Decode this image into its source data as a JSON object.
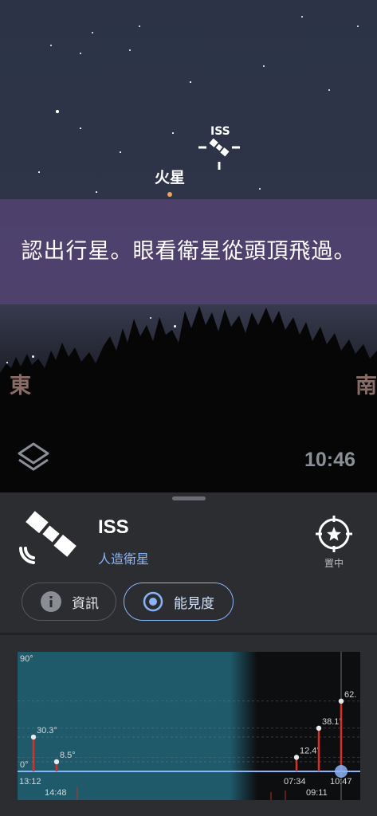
{
  "sky": {
    "planet_label": "火星",
    "satellite_label": "ISS",
    "banner_text": "認出行星。眼看衛星從頭頂飛過。",
    "compass_east": "東",
    "compass_south": "南",
    "time": "10:46",
    "layers_icon": "layers-icon"
  },
  "sheet": {
    "title": "ISS",
    "subtitle": "人造衛星",
    "center_label": "置中",
    "satellite_icon": "satellite-icon",
    "center_icon": "compass-target-icon",
    "tabs": [
      {
        "label": "資訊",
        "icon": "info-icon",
        "active": false
      },
      {
        "label": "能見度",
        "icon": "radio-target-icon",
        "active": true
      }
    ]
  },
  "chart_data": {
    "type": "line",
    "y_labels": [
      "90°",
      "0°"
    ],
    "x_labels": [
      "13:12",
      "14:48",
      "07:34",
      "09:11",
      "10:47"
    ],
    "peak_labels": [
      "30.3°",
      "8.5°",
      "12.4°",
      "38.1°",
      "62."
    ],
    "peaks": [
      30.3,
      8.5,
      12.4,
      38.1,
      62
    ],
    "ylim": [
      0,
      90
    ],
    "colors": {
      "day": "#1f5a6b",
      "night": "#0d0e10",
      "peak": "#d93025",
      "horizon": "#8ab4f8"
    }
  }
}
